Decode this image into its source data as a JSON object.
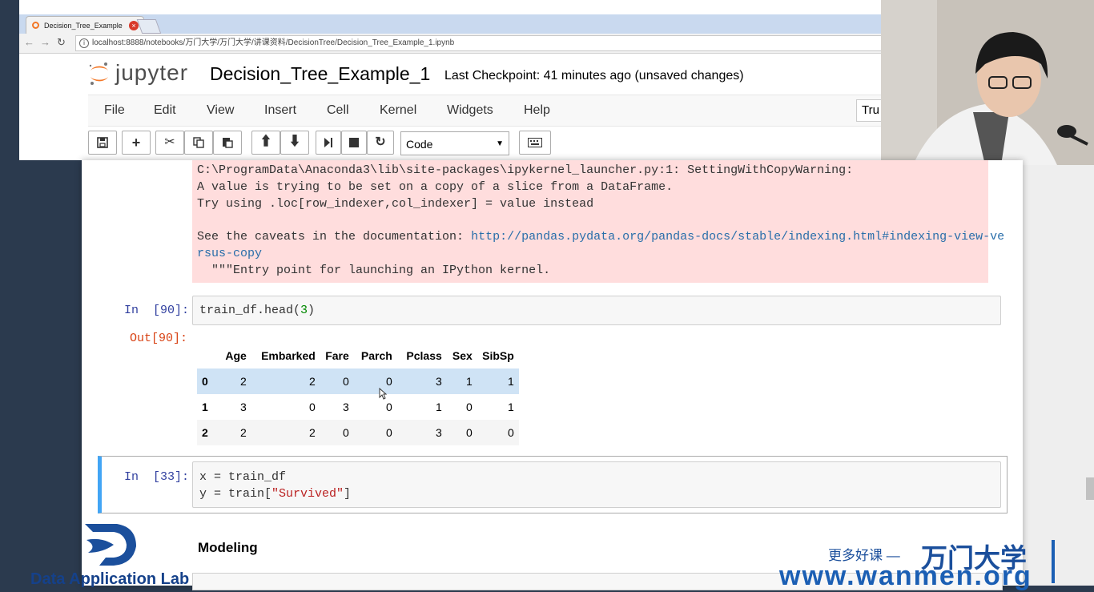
{
  "browser": {
    "tab_title": "Decision_Tree_Example",
    "tab_close": "×",
    "url": "localhost:8888/notebooks/万门大学/万门大学/讲课资料/DecisionTree/Decision_Tree_Example_1.ipynb"
  },
  "jupyter": {
    "logo_text": "jupyter",
    "notebook_title": "Decision_Tree_Example_1",
    "checkpoint": "Last Checkpoint: 41 minutes ago (unsaved changes)",
    "trusted_label": "Tru",
    "menu": [
      "File",
      "Edit",
      "View",
      "Insert",
      "Cell",
      "Kernel",
      "Widgets",
      "Help"
    ],
    "cell_type": "Code",
    "toolbar_icons": [
      "save-icon",
      "plus-icon",
      "cut-icon",
      "copy-icon",
      "paste-icon",
      "arrow-up-icon",
      "arrow-down-icon",
      "step-forward-icon",
      "stop-icon",
      "restart-icon",
      "keyboard-icon"
    ]
  },
  "warning": {
    "line1": "C:\\ProgramData\\Anaconda3\\lib\\site-packages\\ipykernel_launcher.py:1: SettingWithCopyWarning:",
    "line2": "A value is trying to be set on a copy of a slice from a DataFrame.",
    "line3": "Try using .loc[row_indexer,col_indexer] = value instead",
    "line5_prefix": "See the caveats in the documentation: ",
    "link_a": "http://pandas.pydata.org/pandas-docs/stable/indexing.html#indexing-view-ve",
    "link_b": "rsus-copy",
    "line7": "  \"\"\"Entry point for launching an IPython kernel."
  },
  "cell90": {
    "in_prompt": "In  [90]:",
    "code_a": "train_df.head(",
    "code_num": "3",
    "code_b": ")",
    "out_prompt": "Out[90]:"
  },
  "dataframe": {
    "columns": [
      "",
      "Age",
      "Embarked",
      "Fare",
      "Parch",
      "Pclass",
      "Sex",
      "SibSp"
    ],
    "rows": [
      [
        "0",
        "2",
        "2",
        "0",
        "0",
        "3",
        "1",
        "1"
      ],
      [
        "1",
        "3",
        "0",
        "3",
        "0",
        "1",
        "0",
        "1"
      ],
      [
        "2",
        "2",
        "2",
        "0",
        "0",
        "3",
        "0",
        "0"
      ]
    ]
  },
  "cell33": {
    "in_prompt": "In  [33]:",
    "line1": "x = train_df",
    "line2_a": "y = train[",
    "line2_str": "\"Survived\"",
    "line2_b": "]"
  },
  "markdown": {
    "heading": "Modeling"
  },
  "watermark": {
    "lab_name": "Data Application Lab",
    "tagline": "更多好课 —",
    "brand": "万门大学",
    "site": "www.wanmen.org"
  },
  "colors": {
    "warning_bg": "#ffdddd",
    "selected_cell": "#42a5f5",
    "brand_blue": "#1b4f9c",
    "jupyter_orange": "#f37726"
  }
}
